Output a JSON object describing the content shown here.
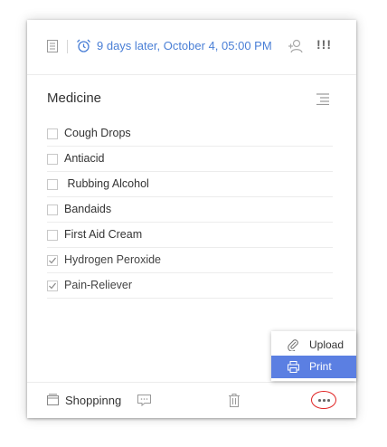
{
  "toolbar": {
    "reminder_text": "9 days later,  October 4, 05:00 PM",
    "priority_label": "!!!",
    "accent_color": "#4a7fd6"
  },
  "list": {
    "title": "Medicine",
    "items": [
      {
        "label": "Cough Drops",
        "checked": false
      },
      {
        "label": "Antiacid",
        "checked": false
      },
      {
        "label": " Rubbing Alcohol",
        "checked": false
      },
      {
        "label": "Bandaids",
        "checked": false
      },
      {
        "label": "First Aid Cream",
        "checked": false
      },
      {
        "label": "Hydrogen Peroxide",
        "checked": true
      },
      {
        "label": "Pain-Reliever",
        "checked": true
      }
    ]
  },
  "footer": {
    "notebook_label": "Shoppinng"
  },
  "popup_menu": {
    "items": [
      {
        "label": "Upload",
        "icon": "paperclip-icon",
        "highlighted": false
      },
      {
        "label": "Print",
        "icon": "printer-icon",
        "highlighted": true
      }
    ],
    "highlight_color": "#5b7fe2"
  },
  "icons": [
    "note-icon",
    "alarm-clock-icon",
    "assign-person-icon",
    "list-mode-icon",
    "notebook-icon",
    "comment-icon",
    "trash-icon",
    "more-icon"
  ]
}
